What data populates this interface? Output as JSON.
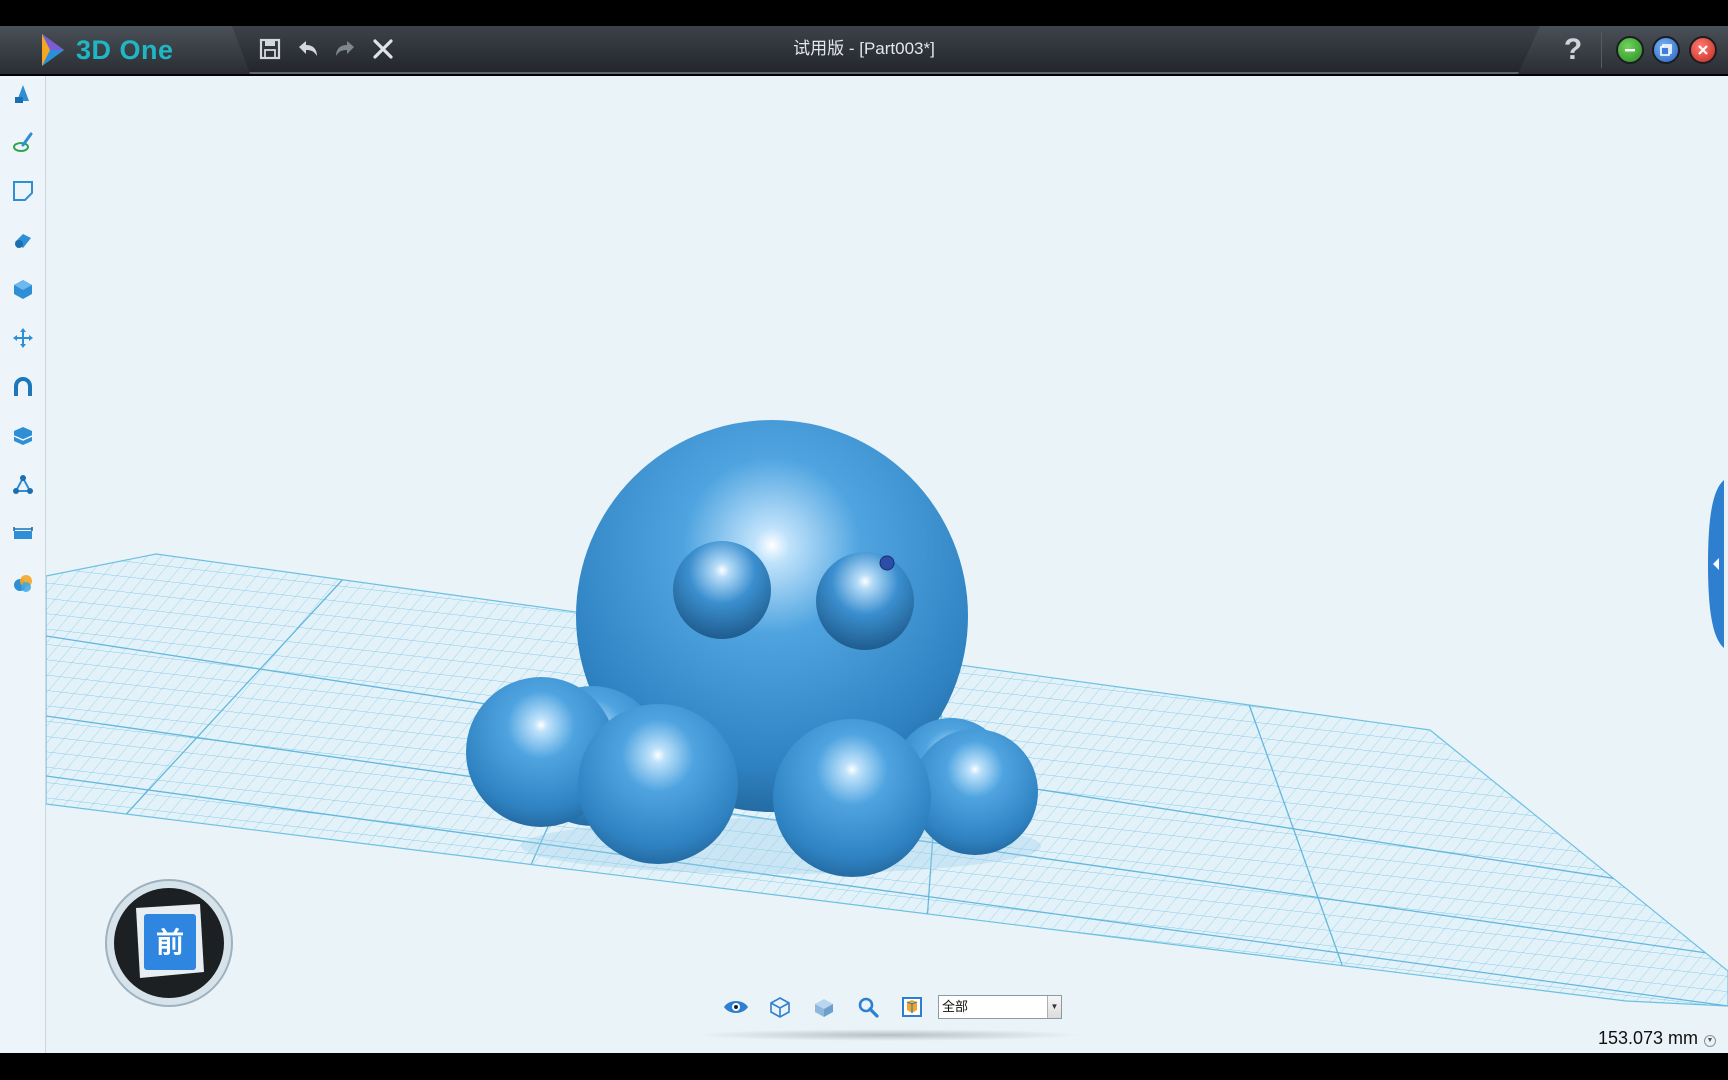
{
  "app": {
    "logo_text": "3D One",
    "window_title": "试用版 - [Part003*]",
    "help_label": "?"
  },
  "toolbar": {
    "quick_access": [
      "save-icon",
      "undo-icon",
      "redo-icon",
      "close-icon"
    ]
  },
  "window_controls": {
    "minimize_color": "#3aa52f",
    "restore_color": "#3a7ed8",
    "close_color": "#e03a32"
  },
  "sidebar": {
    "tools": [
      "basic-solid-icon",
      "sketch-icon",
      "sketch-edit-icon",
      "special-feature-icon",
      "feature-modeling-icon",
      "move-icon",
      "combine-icon",
      "pattern-icon",
      "basic-edit-icon",
      "distance-measure-icon",
      "color-material-icon"
    ]
  },
  "navcube": {
    "face_label": "前"
  },
  "viewbar": {
    "icons": [
      "view-visibility-icon",
      "wireframe-view-icon",
      "shaded-view-icon",
      "zoom-icon",
      "fit-view-icon"
    ],
    "filter_value": "全部"
  },
  "status": {
    "measure": "153.073 mm"
  },
  "colors": {
    "model": "#3a8ccd",
    "grid": "#5fb9de",
    "viewport_bg": "#eaf3f8",
    "accent": "#1fb7c4"
  }
}
